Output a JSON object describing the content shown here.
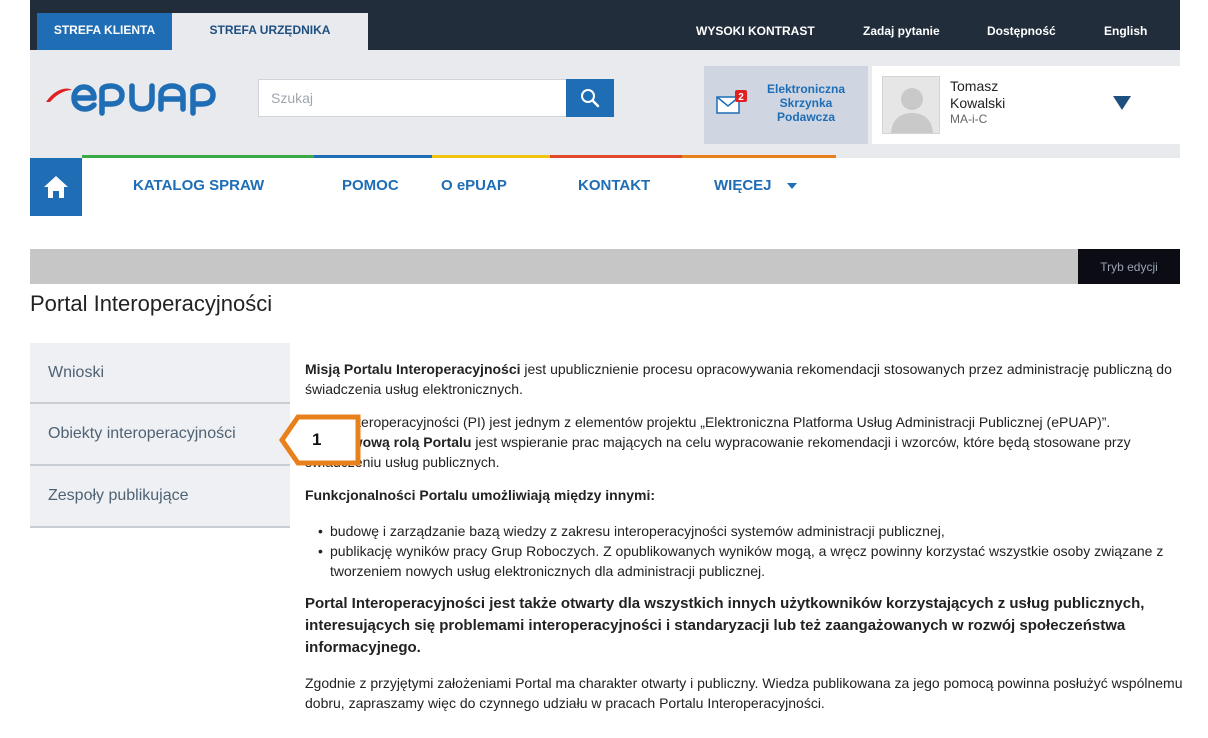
{
  "topbar": {
    "zone_klient": "STREFA KLIENTA",
    "zone_urzednik": "STREFA URZĘDNIKA",
    "high_contrast": "WYSOKI KONTRAST",
    "ask_question": "Zadaj pytanie",
    "accessibility": "Dostępność",
    "english": "English"
  },
  "header": {
    "search_placeholder": "Szukaj",
    "inbox_line1": "Elektroniczna",
    "inbox_line2": "Skrzynka",
    "inbox_line3": "Podawcza",
    "inbox_badge": "2",
    "user_first": "Tomasz",
    "user_last": "Kowalski",
    "user_role": "MA-i-C"
  },
  "nav": {
    "items": [
      "KATALOG SPRAW",
      "POMOC",
      "O ePUAP",
      "KONTAKT",
      "WIĘCEJ"
    ]
  },
  "edit_mode": "Tryb edycji",
  "page_title": "Portal Interoperacyjności",
  "sidebar": {
    "items": [
      "Wnioski",
      "Obiekty interoperacyjności",
      "Zespoły publikujące"
    ]
  },
  "callout_number": "1",
  "content": {
    "p1_bold": "Misją Portalu Interoperacyjności",
    "p1_rest": " jest upublicznienie procesu opracowywania rekomendacji stosowanych przez administrację publiczną do świadczenia usług elektronicznych.",
    "p2_a": "Portal Interoperacyjności (PI) jest jednym z elementów projektu „Elektroniczna Platforma Usług Administracji Publicznej (ePUAP)”. ",
    "p2_bold": "Podstawową rolą Portalu",
    "p2_rest": " jest wspieranie prac mających na celu wypracowanie rekomendacji i wzorców, które będą stosowane przy świadczeniu usług publicznych.",
    "heading": "Funkcjonalności Portalu umożliwiają między innymi:",
    "bullets": [
      "budowę i zarządzanie bazą wiedzy z zakresu interoperacyjności systemów administracji publicznej,",
      "publikację wyników pracy Grup Roboczych. Z opublikowanych wyników mogą, a wręcz powinny korzystać wszystkie osoby związane z tworzeniem nowych usług elektronicznych dla administracji publicznej."
    ],
    "bold_para": "Portal Interoperacyjności jest także otwarty dla wszystkich innych użytkowników korzystających z usług publicznych, interesujących się problemami interoperacyjności i standaryzacji lub też zaangażowanych w rozwój społeczeństwa informacyjnego.",
    "last_para": "Zgodnie z przyjętymi założeniami Portal ma charakter otwarty i publiczny. Wiedza publikowana za jego pomocą powinna posłużyć wspólnemu dobru, zapraszamy więc do czynnego udziału w pracach Portalu Interoperacyjności."
  },
  "colors": {
    "brand_blue": "#1e6db5",
    "dark_bar": "#222d3b",
    "callout_orange": "#e8801c",
    "logo_red": "#e02020"
  }
}
